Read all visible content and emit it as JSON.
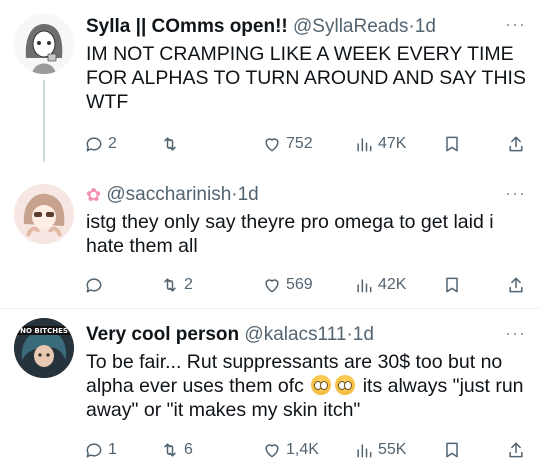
{
  "tweets": [
    {
      "name": "Sylla || COmms open!!",
      "handle": "@SyllaReads",
      "dot": "·",
      "time": "1d",
      "text": "IM NOT CRAMPING LIKE A WEEK EVERY TIME FOR ALPHAS TO TURN AROUND AND SAY THIS WTF",
      "replies": "2",
      "retweets": "",
      "likes": "752",
      "views": "47K"
    },
    {
      "name": "",
      "handle": "@saccharinish",
      "dot": "·",
      "time": "1d",
      "text": "istg they only say theyre pro omega to get laid i hate them all",
      "replies": "",
      "retweets": "2",
      "likes": "569",
      "views": "42K"
    },
    {
      "name": "Very cool person",
      "handle": "@kalacs111",
      "dot": "·",
      "time": "1d",
      "text_part1": "To be fair... Rut suppressants are 30$ too but no alpha ever uses them ofc",
      "text_part2": " its always \"just run away\" or \"it makes my skin itch\"",
      "avatar_text": "NO BITCHES",
      "replies": "1",
      "retweets": "6",
      "likes": "1,4K",
      "views": "55K"
    }
  ],
  "more_label": "···",
  "icons": [
    "reply-icon",
    "retweet-icon",
    "like-icon",
    "views-icon",
    "bookmark-icon",
    "share-icon",
    "more-icon",
    "flower-emoji",
    "rolling-eyes-emoji"
  ],
  "colors": {
    "text": "#0f1419",
    "muted": "#536471",
    "line": "#cfd9de"
  }
}
